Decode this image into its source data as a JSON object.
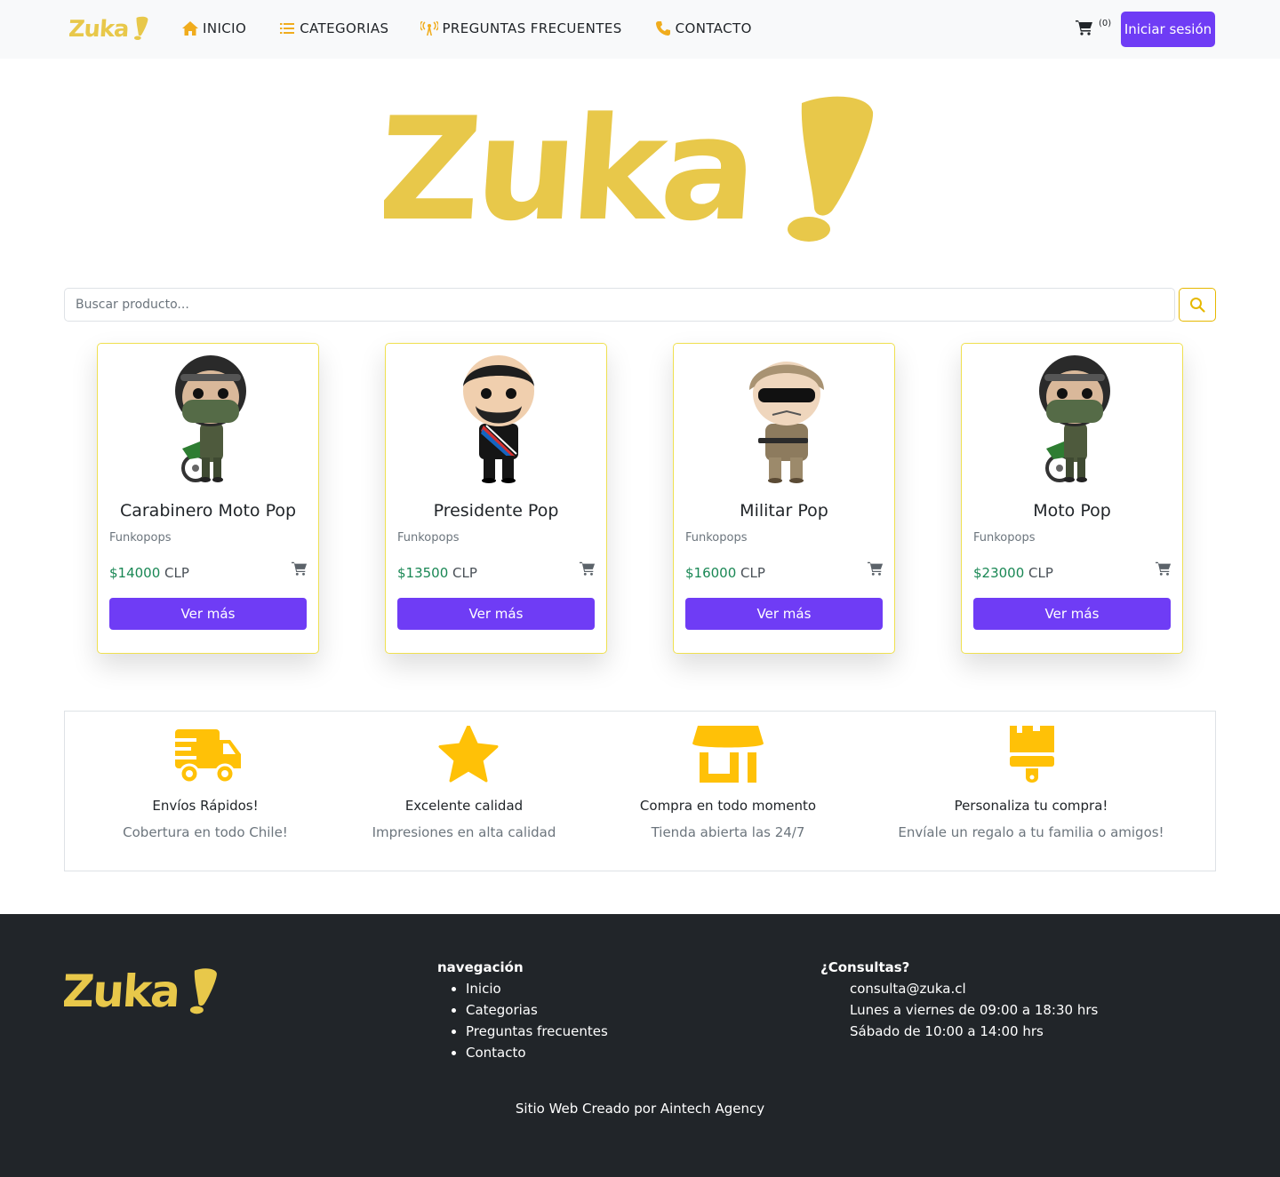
{
  "brand": {
    "name": "Zuka!",
    "color": "#e8c84a"
  },
  "nav": {
    "items": [
      {
        "label": "INICIO",
        "icon": "home-icon"
      },
      {
        "label": "CATEGORIAS",
        "icon": "list-icon"
      },
      {
        "label": "PREGUNTAS FRECUENTES",
        "icon": "broadcast-icon"
      },
      {
        "label": "CONTACTO",
        "icon": "phone-icon"
      }
    ],
    "cart_count": "(0)",
    "login_label": "Iniciar sesión"
  },
  "search": {
    "placeholder": "Buscar producto..."
  },
  "products": [
    {
      "name": "Carabinero Moto Pop",
      "category": "Funkopops",
      "price": "$14000",
      "currency": "CLP",
      "button": "Ver más"
    },
    {
      "name": "Presidente Pop",
      "category": "Funkopops",
      "price": "$13500",
      "currency": "CLP",
      "button": "Ver más"
    },
    {
      "name": "Militar Pop",
      "category": "Funkopops",
      "price": "$16000",
      "currency": "CLP",
      "button": "Ver más"
    },
    {
      "name": "Moto Pop",
      "category": "Funkopops",
      "price": "$23000",
      "currency": "CLP",
      "button": "Ver más"
    }
  ],
  "features": [
    {
      "title": "Envíos Rápidos!",
      "subtitle": "Cobertura en todo Chile!",
      "icon": "truck-fast-icon"
    },
    {
      "title": "Excelente calidad",
      "subtitle": "Impresiones en alta calidad",
      "icon": "star-icon"
    },
    {
      "title": "Compra en todo momento",
      "subtitle": "Tienda abierta las 24/7",
      "icon": "store-icon"
    },
    {
      "title": "Personaliza tu compra!",
      "subtitle": "Envíale un regalo a tu familia o amigos!",
      "icon": "paint-brush-icon"
    }
  ],
  "footer": {
    "nav_title": "navegación",
    "nav_links": [
      "Inicio",
      "Categorias",
      "Preguntas frecuentes",
      "Contacto"
    ],
    "contact_title": "¿Consultas?",
    "contact_lines": [
      "consulta@zuka.cl",
      "Lunes a viernes de 09:00 a 18:30 hrs",
      "Sábado de 10:00 a 14:00 hrs"
    ],
    "credit": "Sitio Web Creado por Aintech Agency"
  },
  "colors": {
    "accent": "#6f3cf5",
    "feature_yellow": "#ffc107",
    "footer_bg": "#212529",
    "price_green": "#198754"
  }
}
